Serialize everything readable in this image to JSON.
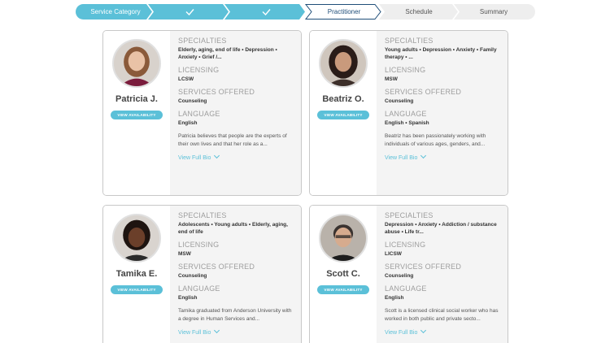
{
  "stepper": {
    "steps": [
      {
        "label": "Service Category",
        "state": "done"
      },
      {
        "label": "",
        "state": "done",
        "icon": "check-icon"
      },
      {
        "label": "",
        "state": "done",
        "icon": "check-icon"
      },
      {
        "label": "Practitioner",
        "state": "active"
      },
      {
        "label": "Schedule",
        "state": "todo"
      },
      {
        "label": "Summary",
        "state": "todo"
      }
    ],
    "colors": {
      "done": "#5bc0d8",
      "active_border": "#1f4e79",
      "todo": "#eeeeee"
    }
  },
  "labels": {
    "specialties": "SPECIALTIES",
    "licensing": "LICENSING",
    "services": "SERVICES OFFERED",
    "language": "LANGUAGE",
    "view_availability": "VIEW AVAILABILITY",
    "view_full_bio": "View Full Bio"
  },
  "practitioners": [
    {
      "name": "Patricia J.",
      "specialties": "Elderly, aging, end of life • Depression • Anxiety • Grief /...",
      "licensing": "LCSW",
      "services": "Counseling",
      "language": "English",
      "bio": "Patricia believes that people are the experts of their own lives and that her role as a..."
    },
    {
      "name": "Beatriz O.",
      "specialties": "Young adults • Depression • Anxiety • Family therapy • ...",
      "licensing": "MSW",
      "services": "Counseling",
      "language": "English • Spanish",
      "bio": "Beatriz has been passionately working with individuals of various ages, genders, and..."
    },
    {
      "name": "Tamika E.",
      "specialties": "Adolescents • Young adults • Elderly, aging, end of life",
      "licensing": "MSW",
      "services": "Counseling",
      "language": "English",
      "bio": "Tamika graduated from Anderson University with a degree in Human Services and..."
    },
    {
      "name": "Scott C.",
      "specialties": "Depression • Anxiety • Addiction / substance abuse • Life tr...",
      "licensing": "LICSW",
      "services": "Counseling",
      "language": "English",
      "bio": "Scott is a licensed clinical social worker who has worked in both public and private secto..."
    }
  ]
}
